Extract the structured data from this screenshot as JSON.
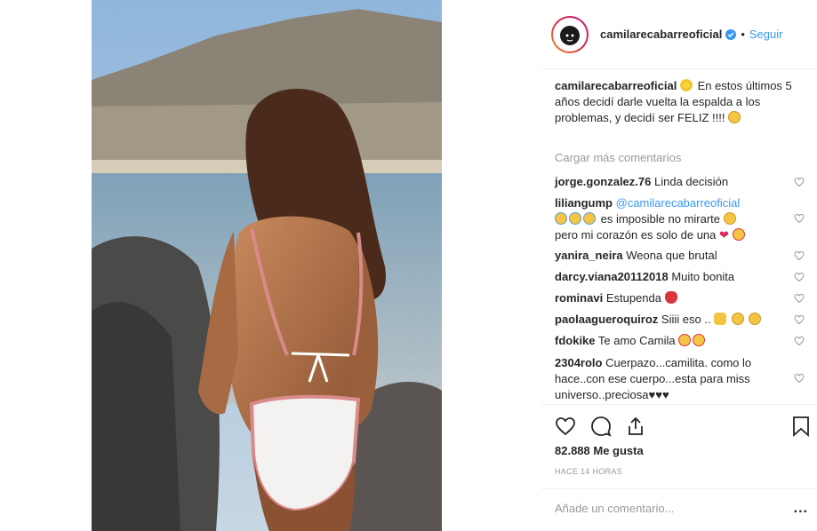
{
  "post": {
    "username": "camilarecabarreoficial",
    "follow_label": "Seguir",
    "separator": "•",
    "caption_user": "camilarecabarreoficial",
    "caption_text": "En estos últimos 5 años decidí darle vuelta la espalda a los problemas, y decidí ser FELIZ !!!!",
    "load_more": "Cargar más comentarios",
    "likes": "82.888 Me gusta",
    "time": "HACE 14 HORAS",
    "add_comment_placeholder": "Añade un comentario...",
    "more": "..."
  },
  "comments": [
    {
      "user": "jorge.gonzalez.76",
      "text": "Linda decisión"
    },
    {
      "user": "liliangump",
      "mention": "@camilarecabarreoficial",
      "text": "es imposible no mirarte",
      "text2": "pero mi corazón es solo de una"
    },
    {
      "user": "yanira_neira",
      "text": "Weona que brutal"
    },
    {
      "user": "darcy.viana20112018",
      "text": "Muito bonita"
    },
    {
      "user": "rominavi",
      "text": "Estupenda"
    },
    {
      "user": "paolaagueroquiroz",
      "text": "Siiii eso .."
    },
    {
      "user": "fdokike",
      "text": "Te amo Camila"
    },
    {
      "user": "2304rolo",
      "text": "Cuerpazo...camilita. como lo hace..con ese cuerpo...esta para miss universo..preciosa",
      "suffix": "♥♥♥"
    }
  ],
  "colors": {
    "link": "#3897f0",
    "muted": "#999999",
    "text": "#262626",
    "border": "#efefef"
  }
}
